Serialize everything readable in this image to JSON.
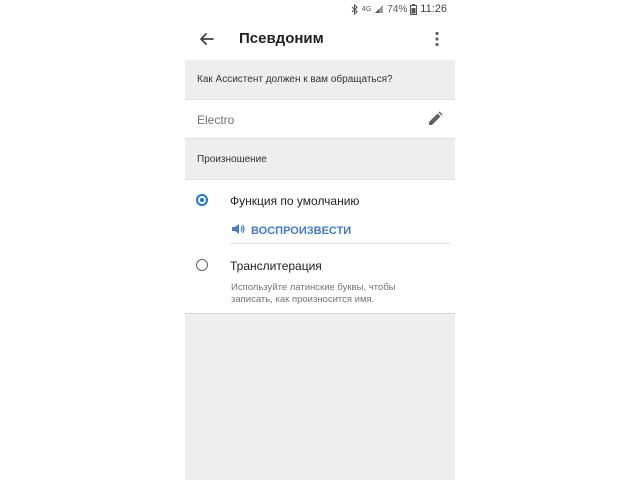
{
  "status_bar": {
    "network": "4G",
    "battery": "74%",
    "time": "11:26"
  },
  "app_bar": {
    "title": "Псевдоним"
  },
  "nickname_section": {
    "header": "Как Ассистент должен к вам обращаться?",
    "value": "Electro"
  },
  "pronunciation_section": {
    "header": "Произношение",
    "options": [
      {
        "label": "Функция по умолчанию",
        "selected": true,
        "play_label": "ВОСПРОИЗВЕСТИ"
      },
      {
        "label": "Транслитерация",
        "selected": false,
        "hint": "Используйте латинские буквы, чтобы записать, как произносится имя."
      }
    ]
  },
  "colors": {
    "accent": "#1a73e8",
    "play": "#3b7cd6",
    "background": "#eeeeee"
  }
}
